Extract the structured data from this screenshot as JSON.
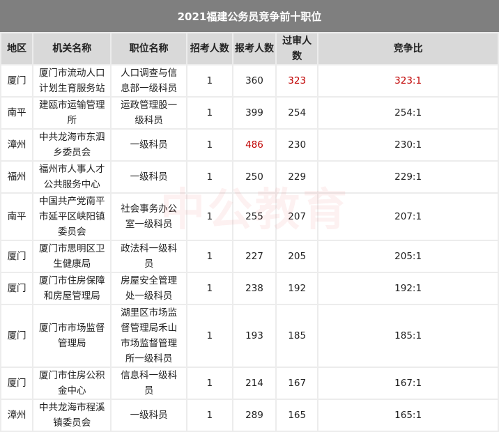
{
  "title": "2021福建公务员竞争前十职位",
  "watermark": "中公教育",
  "headers": [
    "地区",
    "机关名称",
    "职位名称",
    "招考人数",
    "报考人数",
    "过审人数",
    "竞争比"
  ],
  "rows": [
    [
      "厦门",
      "厦门市流动人口计划生育服务站",
      "人口调查与信息部一级科员",
      "1",
      "360",
      "323",
      "323:1"
    ],
    [
      "南平",
      "建瓯市运输管理所",
      "运政管理股一级科员",
      "1",
      "399",
      "254",
      "254:1"
    ],
    [
      "漳州",
      "中共龙海市东泗乡委员会",
      "一级科员",
      "1",
      "486",
      "230",
      "230:1"
    ],
    [
      "福州",
      "福州市人事人才公共服务中心",
      "一级科员",
      "1",
      "250",
      "229",
      "229:1"
    ],
    [
      "南平",
      "中国共产党南平市延平区峡阳镇委员会",
      "社会事务办公室一级科员",
      "1",
      "255",
      "207",
      "207:1"
    ],
    [
      "厦门",
      "厦门市思明区卫生健康局",
      "政法科一级科员",
      "1",
      "227",
      "205",
      "205:1"
    ],
    [
      "厦门",
      "厦门市住房保障和房屋管理局",
      "房屋安全管理处一级科员",
      "1",
      "238",
      "192",
      "192:1"
    ],
    [
      "厦门",
      "厦门市市场监督管理局",
      "湖里区市场监督管理局禾山市场监督管理所一级科员",
      "1",
      "193",
      "185",
      "185:1"
    ],
    [
      "厦门",
      "厦门市住房公积金中心",
      "信息科一级科员",
      "1",
      "214",
      "167",
      "167:1"
    ],
    [
      "漳州",
      "中共龙海市程溪镇委员会",
      "一级科员",
      "1",
      "289",
      "165",
      "165:1"
    ]
  ],
  "highlight_color": "#c00000"
}
